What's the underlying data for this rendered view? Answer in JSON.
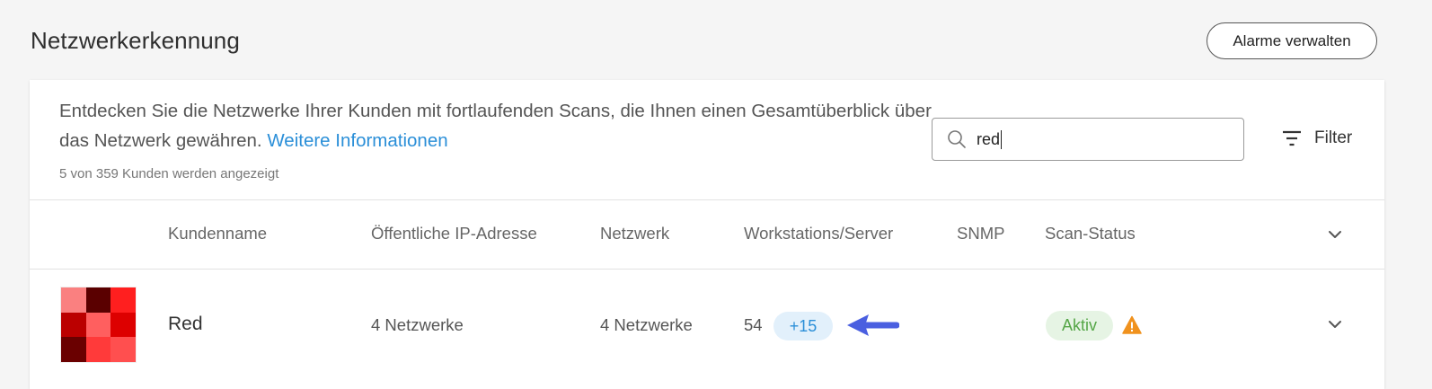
{
  "header": {
    "title": "Netzwerkerkennung",
    "manage_alarms_label": "Alarme verwalten"
  },
  "intro": {
    "description": "Entdecken Sie die Netzwerke Ihrer Kunden mit fortlaufenden Scans, die Ihnen einen Gesamtüberblick über das Netzwerk gewähren.",
    "more_info_link": "Weitere Informationen",
    "customer_count": "5 von 359 Kunden werden angezeigt"
  },
  "search": {
    "value": "red",
    "icon": "search-icon"
  },
  "filter": {
    "label": "Filter",
    "icon": "filter-icon"
  },
  "table": {
    "columns": {
      "name": "Kundenname",
      "public_ip": "Öffentliche IP-Adresse",
      "network": "Netzwerk",
      "workstations": "Workstations/Server",
      "snmp": "SNMP",
      "scan_status": "Scan-Status"
    },
    "rows": [
      {
        "name": "Red",
        "public_ip": "4 Netzwerke",
        "network": "4 Netzwerke",
        "workstations": "54",
        "workstations_extra": "+15",
        "snmp": "",
        "scan_status": "Aktiv",
        "warning_icon": "warning-icon",
        "logo_colors": [
          "#fa8080",
          "#5a0000",
          "#ff1f1f",
          "#bb0000",
          "#ff5f5f",
          "#dd0000",
          "#6a0000",
          "#ff3a3a",
          "#ff4f4f"
        ]
      }
    ]
  },
  "colors": {
    "link": "#2b8fd8",
    "status_active_bg": "#e6f4e4",
    "status_active_text": "#55a647",
    "badge_bg": "#e2f0fb",
    "warning": "#f0921e",
    "arrow": "#4a5fe0"
  }
}
